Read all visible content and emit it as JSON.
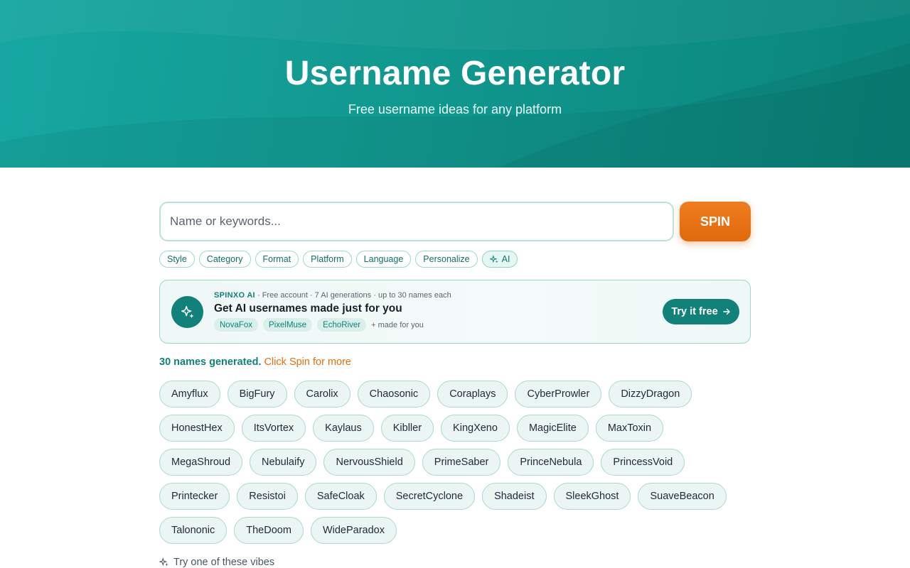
{
  "hero": {
    "title": "Username Generator",
    "subtitle": "Free username ideas for any platform"
  },
  "search": {
    "placeholder": "Name or keywords...",
    "value": "",
    "spin_label": "SPIN"
  },
  "filters": [
    "Style",
    "Category",
    "Format",
    "Platform",
    "Language",
    "Personalize",
    "AI"
  ],
  "promo": {
    "brand": "SPINXO AI",
    "meta": " · Free account · 7 AI generations · up to 30 names each",
    "headline": "Get AI usernames made just for you",
    "samples": [
      "NovaFox",
      "PixelMuse",
      "EchoRiver"
    ],
    "made_for_you": "+ made for you",
    "cta_label": "Try it free",
    "icon": "sparkles-icon"
  },
  "status": {
    "count_text": "30 names generated.",
    "more_text": "Click Spin for more"
  },
  "names": [
    "Amyflux",
    "BigFury",
    "Carolix",
    "Chaosonic",
    "Coraplays",
    "CyberProwler",
    "DizzyDragon",
    "HonestHex",
    "ItsVortex",
    "Kaylaus",
    "Kibller",
    "KingXeno",
    "MagicElite",
    "MaxToxin",
    "MegaShroud",
    "Nebulaify",
    "NervousShield",
    "PrimeSaber",
    "PrinceNebula",
    "PrincessVoid",
    "Printecker",
    "Resistoi",
    "SafeCloak",
    "SecretCyclone",
    "Shadeist",
    "SleekGhost",
    "SuaveBeacon",
    "Talononic",
    "TheDoom",
    "WideParadox"
  ],
  "vibes": {
    "label": "Try one of these vibes"
  },
  "colors": {
    "teal": "#12817a",
    "orange": "#e0700f",
    "hero_start": "#17a7a2",
    "hero_end": "#0a857b"
  }
}
